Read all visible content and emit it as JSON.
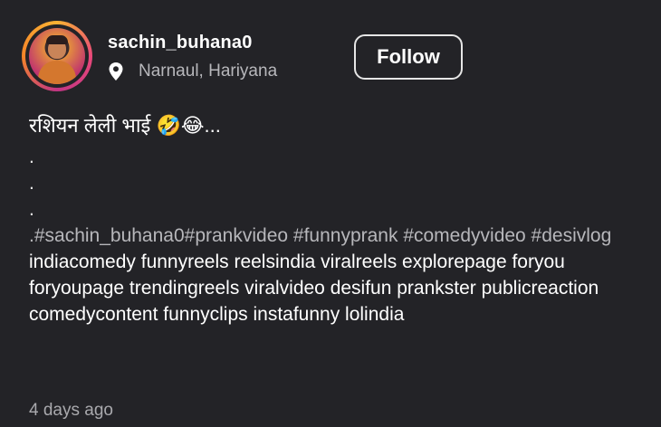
{
  "profile": {
    "username": "sachin_buhana0",
    "location": "Narnaul, Hariyana",
    "location_icon": "pin-icon",
    "follow_label": "Follow"
  },
  "post": {
    "title": "रशियन लेली भाई 🤣😂...",
    "dots": [
      ".",
      ".",
      "."
    ],
    "hashtags": ".#sachin_buhana0#prankvideo #funnyprank #comedyvideo #desivlog",
    "tags": " indiacomedy funnyreels reelsindia viralreels explorepage foryou foryoupage trendingreels viralvideo desifun prankster publicreaction comedycontent funnyclips instafunny lolindia",
    "timestamp": "4 days ago"
  },
  "colors": {
    "background": "#232327",
    "text": "#ffffff",
    "muted": "#b7b7bb"
  }
}
